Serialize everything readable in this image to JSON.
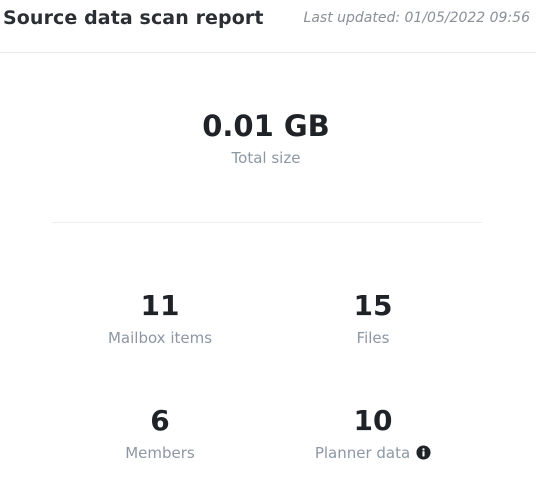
{
  "header": {
    "title": "Source data scan report",
    "last_updated": "Last updated: 01/05/2022 09:56"
  },
  "total": {
    "value": "0.01 GB",
    "label": "Total size"
  },
  "stats": [
    {
      "value": "11",
      "label": "Mailbox items"
    },
    {
      "value": "15",
      "label": "Files"
    },
    {
      "value": "6",
      "label": "Members"
    },
    {
      "value": "10",
      "label": "Planner data"
    }
  ],
  "icons": {
    "planner_info": "info-icon"
  },
  "colors": {
    "title": "#2b2f33",
    "muted": "#8d97a3",
    "number": "#1f2327"
  }
}
